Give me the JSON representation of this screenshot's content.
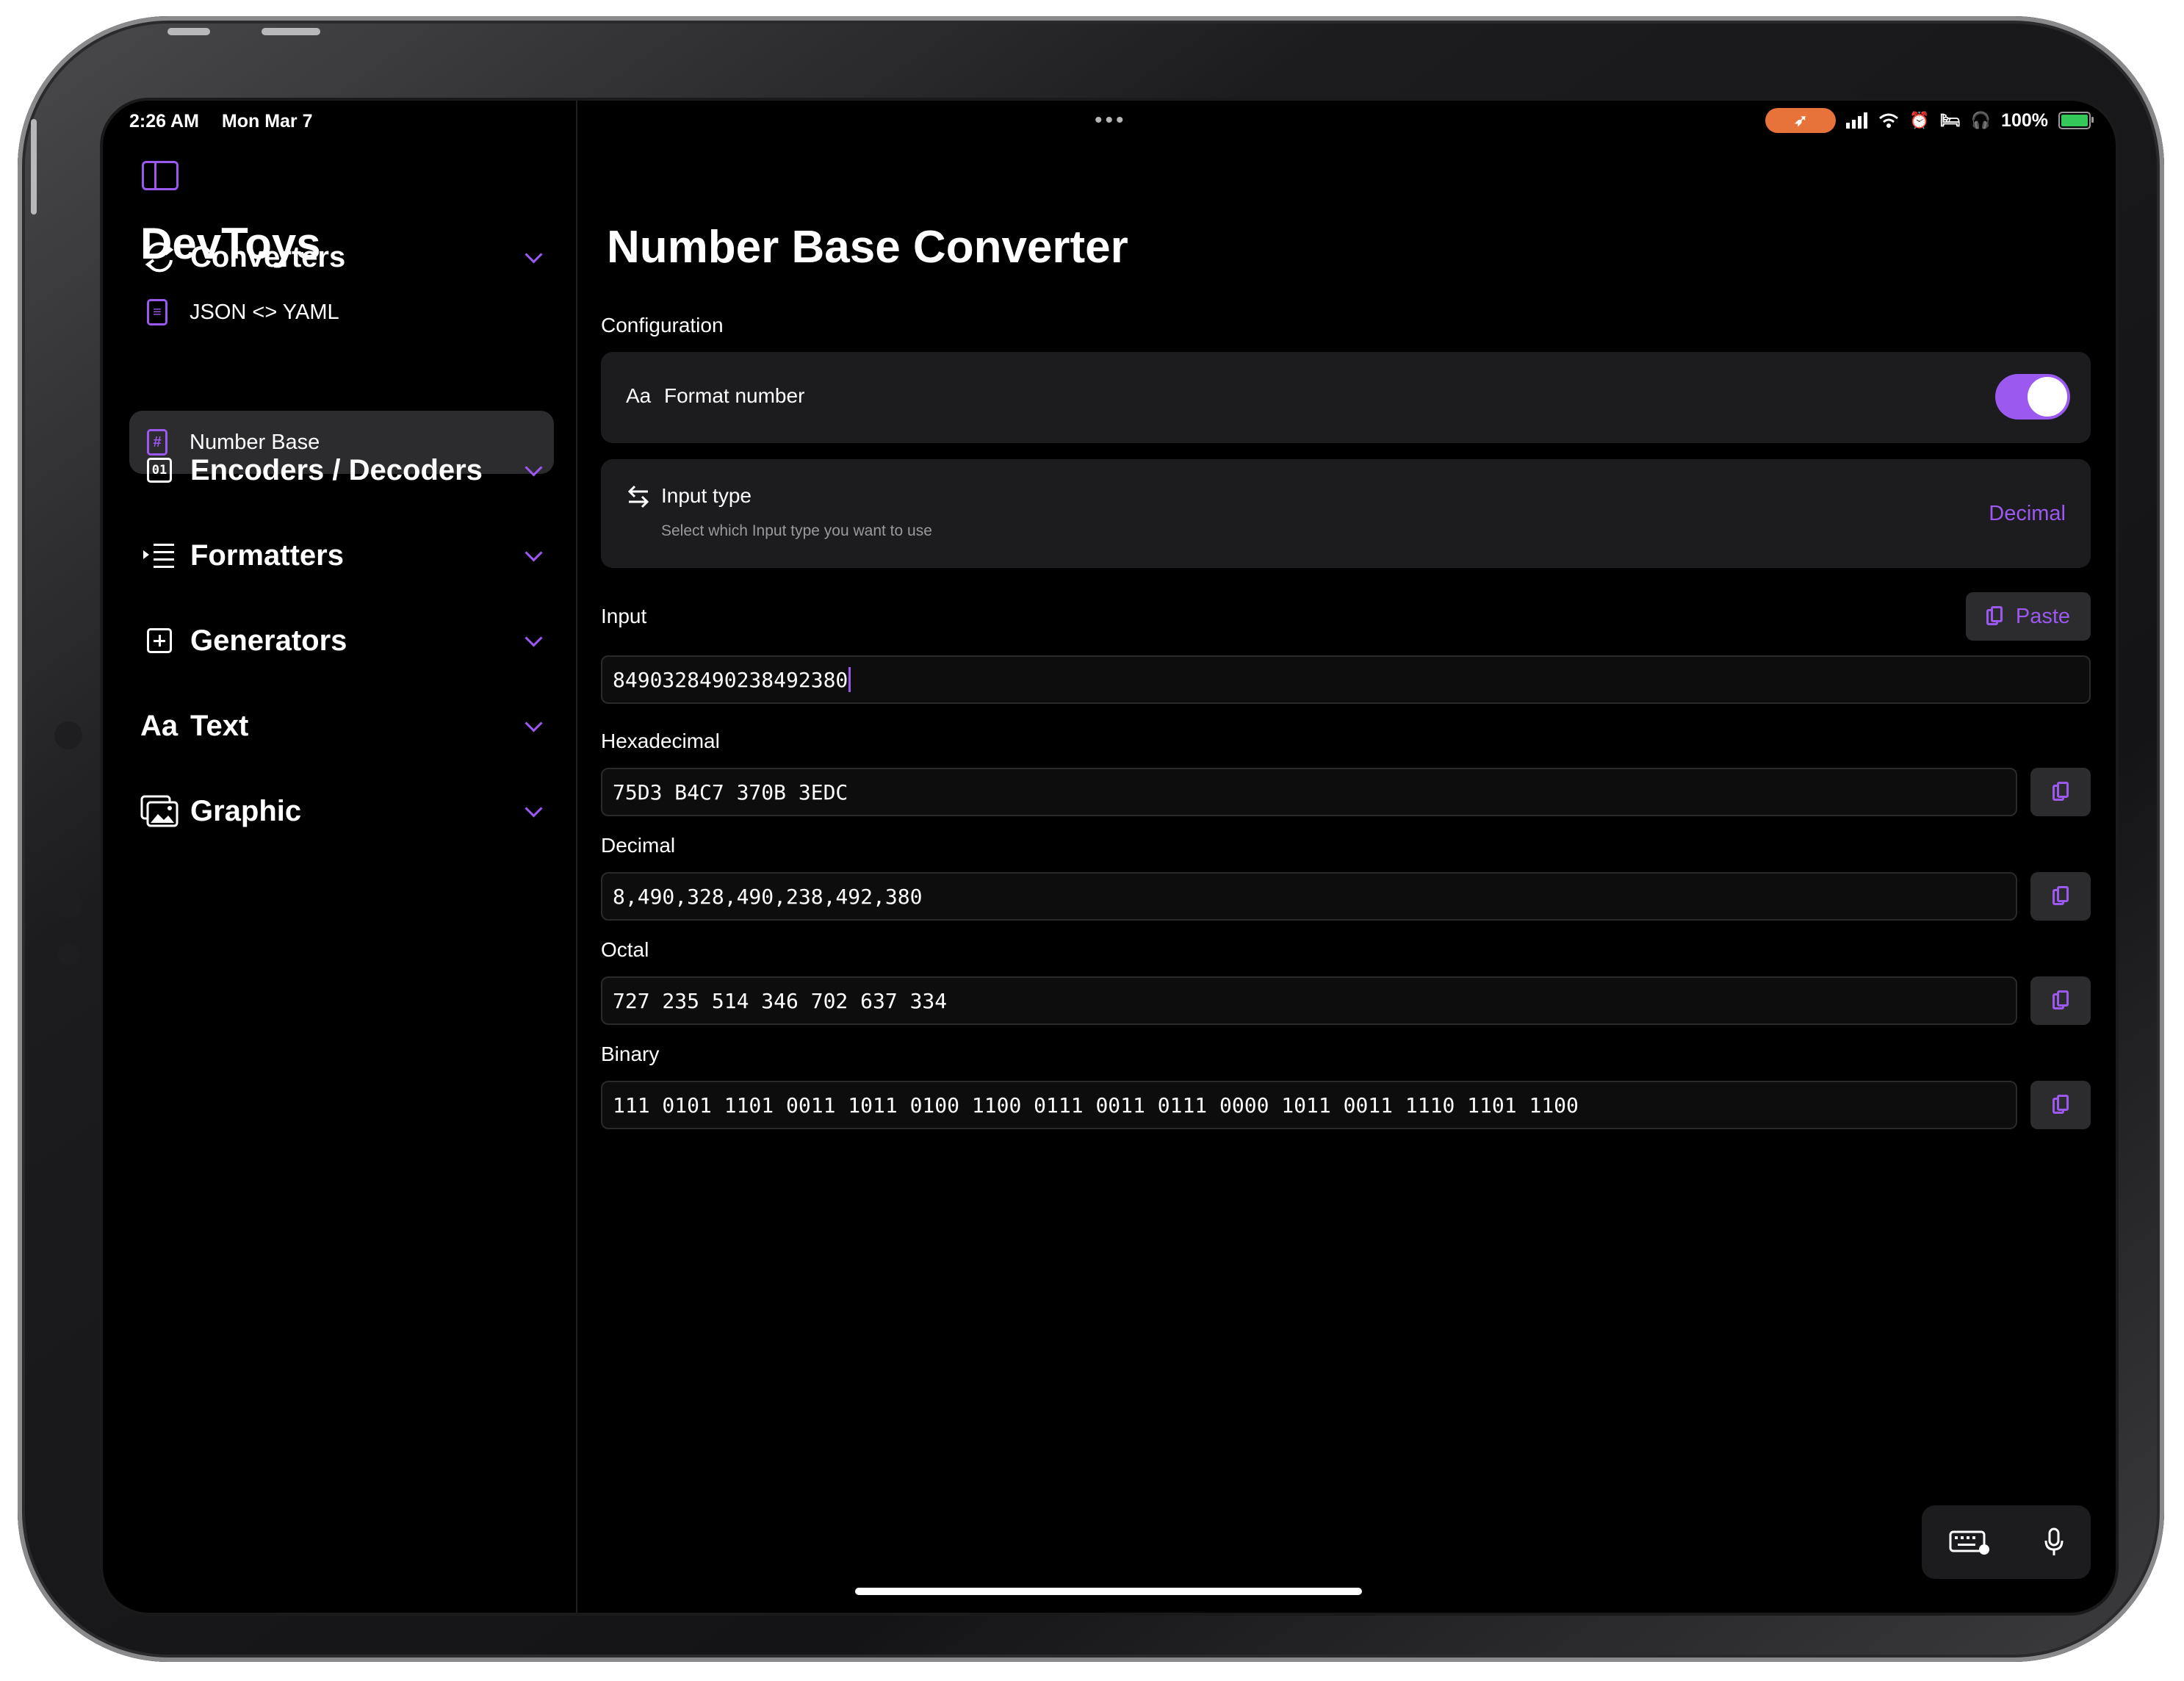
{
  "status_bar": {
    "time": "2:26 AM",
    "date": "Mon Mar 7",
    "battery": "100%"
  },
  "sidebar": {
    "app_title": "DevToys",
    "sections": [
      {
        "label": "Converters",
        "icon": "refresh-icon"
      },
      {
        "label": "Encoders / Decoders",
        "icon": "binary-01-icon"
      },
      {
        "label": "Formatters",
        "icon": "indent-list-icon"
      },
      {
        "label": "Generators",
        "icon": "plus-square-icon"
      },
      {
        "label": "Text",
        "icon": "text-aa-icon"
      },
      {
        "label": "Graphic",
        "icon": "photos-icon"
      }
    ],
    "items": [
      {
        "label": "JSON <> YAML",
        "icon": "document-icon"
      },
      {
        "label": "Number Base",
        "icon": "hash-icon",
        "selected": true
      }
    ],
    "icon_glyphs": {
      "text": "Aa",
      "binary": "01",
      "hash": "#"
    }
  },
  "main": {
    "title": "Number Base Converter",
    "configuration_label": "Configuration",
    "format_number": {
      "icon_text": "Aa",
      "label": "Format number",
      "enabled": true
    },
    "input_type": {
      "label": "Input type",
      "description": "Select which Input type you want to use",
      "value": "Decimal"
    },
    "input": {
      "label": "Input",
      "paste_label": "Paste",
      "value": "8490328490238492380"
    },
    "outputs": [
      {
        "label": "Hexadecimal",
        "value": "75D3 B4C7 370B 3EDC"
      },
      {
        "label": "Decimal",
        "value": "8,490,328,490,238,492,380"
      },
      {
        "label": "Octal",
        "value": "727 235 514 346 702 637 334"
      },
      {
        "label": "Binary",
        "value": "111 0101 1101 0011 1011 0100 1100 0111 0011 0111 0000 1011 0011 1110 1101 1100"
      }
    ]
  },
  "colors": {
    "accent": "#9b59f0",
    "background": "#000000",
    "card": "#1c1c1e",
    "status_pill": "#e8733a"
  }
}
